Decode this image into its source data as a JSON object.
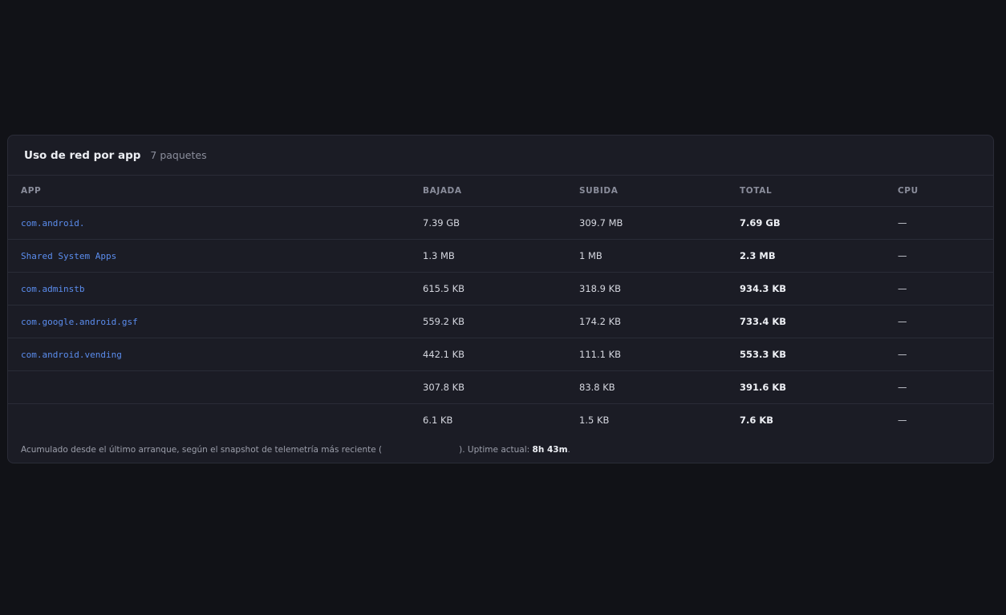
{
  "panel": {
    "title": "Uso de red por app",
    "count": "7 paquetes"
  },
  "table": {
    "columns": [
      "APP",
      "BAJADA",
      "SUBIDA",
      "TOTAL",
      "CPU"
    ],
    "rows": [
      {
        "app": "com.android.",
        "down": "7.39 GB",
        "up": "309.7 MB",
        "total": "7.69 GB",
        "cpu": "—"
      },
      {
        "app": "Shared System Apps",
        "down": "1.3 MB",
        "up": "1 MB",
        "total": "2.3 MB",
        "cpu": "—"
      },
      {
        "app": "com.adminstb",
        "down": "615.5 KB",
        "up": "318.9 KB",
        "total": "934.3 KB",
        "cpu": "—"
      },
      {
        "app": "com.google.android.gsf",
        "down": "559.2 KB",
        "up": "174.2 KB",
        "total": "733.4 KB",
        "cpu": "—"
      },
      {
        "app": "com.android.vending",
        "down": "442.1 KB",
        "up": "111.1 KB",
        "total": "553.3 KB",
        "cpu": "—"
      },
      {
        "app": "",
        "down": "307.8 KB",
        "up": "83.8 KB",
        "total": "391.6 KB",
        "cpu": "—"
      },
      {
        "app": "",
        "down": "6.1 KB",
        "up": "1.5 KB",
        "total": "7.6 KB",
        "cpu": "—"
      }
    ]
  },
  "footer": {
    "prefix": "Acumulado desde el último arranque, según el snapshot de telemetría más reciente (",
    "suffix": "). Uptime actual: ",
    "uptime": "8h 43m",
    "end": "."
  },
  "colors": {
    "background": "#111217",
    "panel": "#1b1c25",
    "border": "#2a2c37",
    "link": "#5b8dee"
  }
}
